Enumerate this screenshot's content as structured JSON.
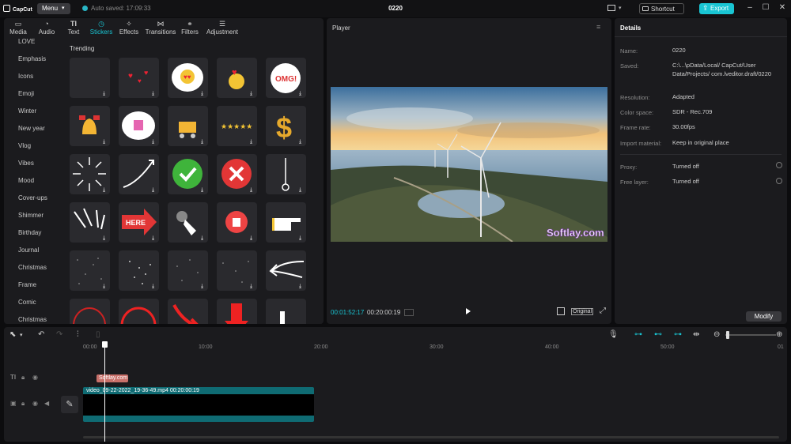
{
  "titlebar": {
    "logo": "CapCut",
    "menu_label": "Menu",
    "autosave": "Auto saved: 17:09:33",
    "project_name": "0220",
    "shortcut_label": "Shortcut",
    "export_label": "Export"
  },
  "tabs": [
    {
      "label": "Media",
      "icon": "media-icon"
    },
    {
      "label": "Audio",
      "icon": "audio-icon"
    },
    {
      "label": "Text",
      "icon": "text-icon"
    },
    {
      "label": "Stickers",
      "icon": "stickers-icon"
    },
    {
      "label": "Effects",
      "icon": "effects-icon"
    },
    {
      "label": "Transitions",
      "icon": "transitions-icon"
    },
    {
      "label": "Filters",
      "icon": "filters-icon"
    },
    {
      "label": "Adjustment",
      "icon": "adjustment-icon"
    }
  ],
  "categories": [
    "LOVE",
    "Emphasis",
    "Icons",
    "Emoji",
    "Winter",
    "New year",
    "Vlog",
    "Vibes",
    "Mood",
    "Cover-ups",
    "Shimmer",
    "Birthday",
    "Journal",
    "Christmas",
    "Frame",
    "Comic",
    "Christmas"
  ],
  "stickers": {
    "section_title": "Trending",
    "here_label": "HERE",
    "omg_label": "OMG!"
  },
  "player": {
    "title": "Player",
    "current_time": "00:01:52:17",
    "duration": "00:20:00:19",
    "original_label": "Original",
    "watermark": "Softlay.com"
  },
  "details": {
    "title": "Details",
    "rows": [
      {
        "key": "Name:",
        "value": "0220"
      },
      {
        "key": "Saved:",
        "value": "C:\\...\\pData/Local/ CapCut/User Data/Projects/ com.lveditor.draft/0220"
      },
      {
        "key": "Resolution:",
        "value": "Adapted"
      },
      {
        "key": "Color space:",
        "value": "SDR - Rec.709"
      },
      {
        "key": "Frame rate:",
        "value": "30.00fps"
      },
      {
        "key": "Import material:",
        "value": "Keep in original place"
      },
      {
        "key": "Proxy:",
        "value": "Turned off"
      },
      {
        "key": "Free layer:",
        "value": "Turned off"
      }
    ],
    "modify_label": "Modify"
  },
  "timeline": {
    "ticks": [
      "00:00",
      "10:00",
      "20:00",
      "30:00",
      "40:00",
      "50:00",
      "01"
    ],
    "text_clip_label": "Softlay.com",
    "video_clip_label": "video_09-22-2022_19-36-49.mp4  00:20:00:19"
  }
}
